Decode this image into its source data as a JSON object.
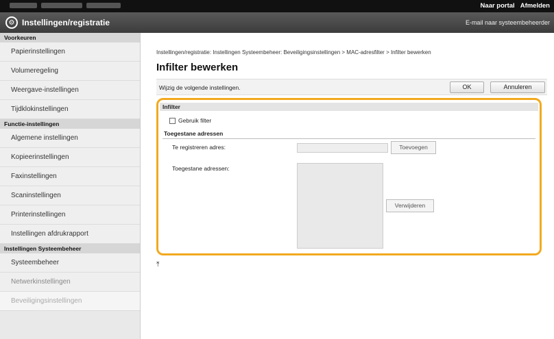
{
  "topbar": {
    "portal_link": "Naar portal",
    "logout_link": "Afmelden"
  },
  "header": {
    "app_title": "Instellingen/registratie",
    "mail_admin": "E-mail naar systeembeheerder"
  },
  "sidebar": {
    "sections": [
      {
        "title": "Voorkeuren",
        "items": [
          "Papierinstellingen",
          "Volumeregeling",
          "Weergave-instellingen",
          "Tijdklokinstellingen"
        ]
      },
      {
        "title": "Functie-instellingen",
        "items": [
          "Algemene instellingen",
          "Kopieerinstellingen",
          "Faxinstellingen",
          "Scaninstellingen",
          "Printerinstellingen",
          "Instellingen afdrukrapport"
        ]
      },
      {
        "title": "Instellingen Systeembeheer",
        "items": [
          "Systeembeheer",
          "Netwerkinstellingen",
          "Beveiligingsinstellingen"
        ]
      }
    ]
  },
  "main": {
    "breadcrumb": "Instellingen/registratie: Instellingen Systeembeheer: Beveiligingsinstellingen > MAC-adresfilter > Infilter bewerken",
    "title": "Infilter bewerken",
    "instruction": "Wijzig de volgende instellingen.",
    "ok_label": "OK",
    "cancel_label": "Annuleren",
    "panel": {
      "header": "Infilter",
      "use_filter_label": "Gebruik filter",
      "use_filter_checked": false,
      "allowed_heading": "Toegestane adressen",
      "register_label": "Te registreren adres:",
      "register_value": "",
      "add_label": "Toevoegen",
      "allowed_list_label": "Toegestane adressen:",
      "allowed_list": [],
      "delete_label": "Verwijderen"
    },
    "to_top_glyph": "⤒"
  },
  "colors": {
    "highlight": "#f2a91e",
    "topbar": "#111111",
    "titlebar": "#4a4a4a"
  }
}
